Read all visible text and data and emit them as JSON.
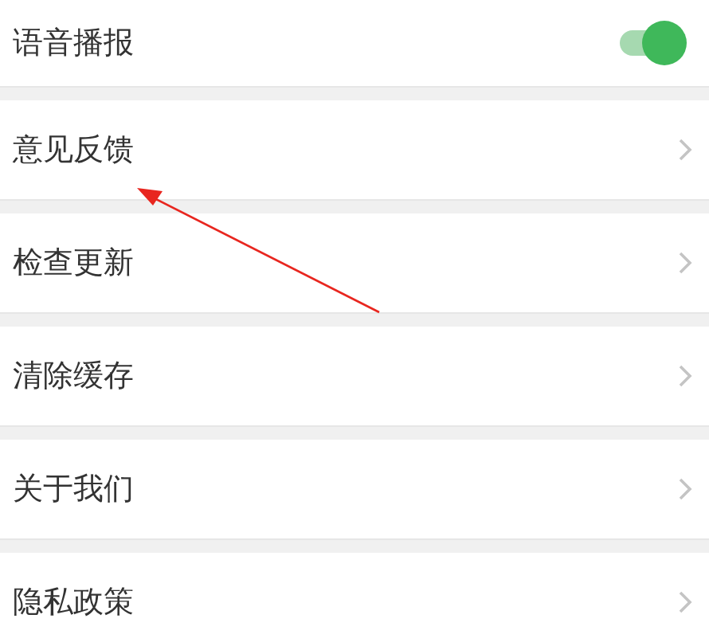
{
  "settings": [
    {
      "kind": "toggle",
      "label": "语音播报",
      "on": true
    },
    {
      "kind": "link",
      "label": "意见反馈"
    },
    {
      "kind": "link",
      "label": "检查更新"
    },
    {
      "kind": "link",
      "label": "清除缓存"
    },
    {
      "kind": "link",
      "label": "关于我们"
    },
    {
      "kind": "link",
      "label": "隐私政策"
    }
  ]
}
